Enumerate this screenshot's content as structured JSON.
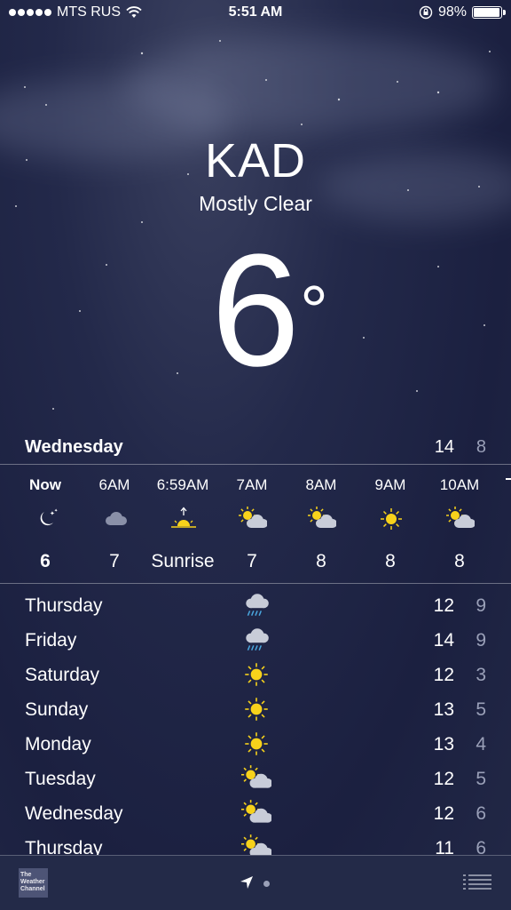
{
  "status_bar": {
    "carrier": "MTS RUS",
    "time": "5:51 AM",
    "battery": "98%",
    "battery_level": 0.98
  },
  "location": {
    "city": "KAD",
    "condition": "Mostly Clear",
    "temperature": "6",
    "degree_symbol": "°"
  },
  "today": {
    "day": "Wednesday",
    "high": "14",
    "low": "8"
  },
  "hourly": [
    {
      "time": "Now",
      "icon": "moon-stars-icon",
      "value": "6"
    },
    {
      "time": "6AM",
      "icon": "cloud-icon",
      "value": "7"
    },
    {
      "time": "6:59AM",
      "icon": "sunrise-icon",
      "value": "Sunrise"
    },
    {
      "time": "7AM",
      "icon": "partly-cloudy-icon",
      "value": "7"
    },
    {
      "time": "8AM",
      "icon": "partly-cloudy-icon",
      "value": "8"
    },
    {
      "time": "9AM",
      "icon": "sun-icon",
      "value": "8"
    },
    {
      "time": "10AM",
      "icon": "partly-cloudy-icon",
      "value": "8"
    }
  ],
  "daily": [
    {
      "day": "Thursday",
      "icon": "rain-icon",
      "high": "12",
      "low": "9"
    },
    {
      "day": "Friday",
      "icon": "rain-icon",
      "high": "14",
      "low": "9"
    },
    {
      "day": "Saturday",
      "icon": "sun-icon",
      "high": "12",
      "low": "3"
    },
    {
      "day": "Sunday",
      "icon": "sun-icon",
      "high": "13",
      "low": "5"
    },
    {
      "day": "Monday",
      "icon": "sun-icon",
      "high": "13",
      "low": "4"
    },
    {
      "day": "Tuesday",
      "icon": "partly-cloudy-icon",
      "high": "12",
      "low": "5"
    },
    {
      "day": "Wednesday",
      "icon": "partly-cloudy-icon",
      "high": "12",
      "low": "6"
    },
    {
      "day": "Thursday",
      "icon": "partly-cloudy-icon",
      "high": "11",
      "low": "6"
    }
  ],
  "bottom_bar": {
    "logo_text": "The Weather Channel"
  },
  "colors": {
    "sun": "#f7d21b",
    "cloud": "#c8ccd8",
    "rain": "#4aa8e0",
    "secondary_text": "#9aa0b8"
  }
}
